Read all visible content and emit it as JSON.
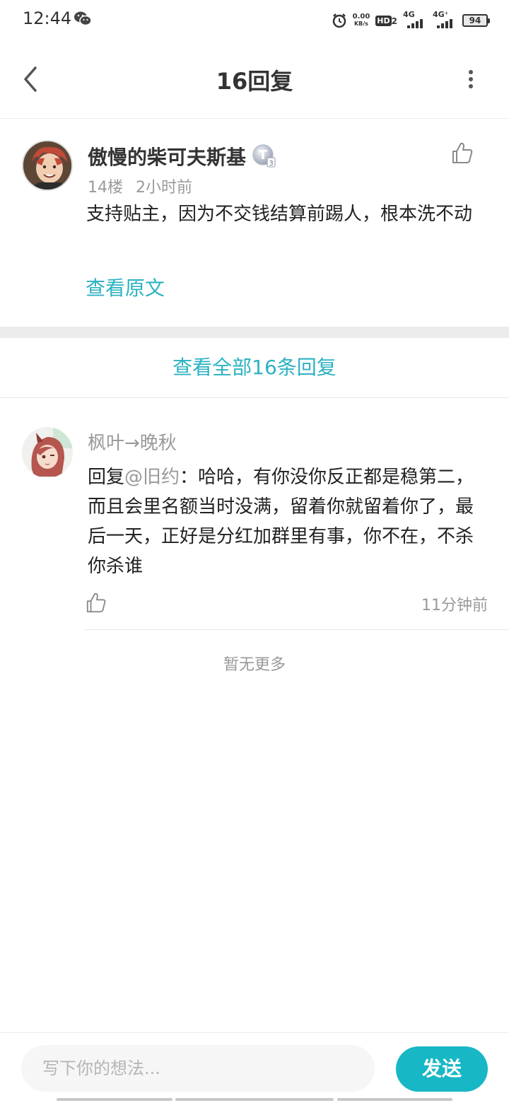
{
  "status_bar": {
    "time": "12:44",
    "net_speed_value": "0.00",
    "net_speed_unit": "KB/s",
    "hd_label": "HD",
    "hd_sub": "2",
    "net1": "4G",
    "net2": "4G⁺",
    "battery": "94",
    "icons": [
      "wechat-icon",
      "alarm-icon",
      "signal-icon",
      "battery-icon"
    ]
  },
  "header": {
    "title": "16回复"
  },
  "main_comment": {
    "author": "傲慢的柴可夫斯基",
    "badge_letter": "T",
    "badge_level": "3",
    "floor": "14楼",
    "time": "2小时前",
    "content": "支持贴主，因为不交钱结算前踢人，根本洗不动",
    "view_original": "查看原文"
  },
  "view_all": "查看全部16条回复",
  "replies": [
    {
      "author": "枫叶→晚秋",
      "prefix": "回复",
      "mention": "@旧约",
      "text": "：哈哈，有你没你反正都是稳第二，而且会里名额当时没满，留着你就留着你了，最后一天，正好是分红加群里有事，你不在，不杀你杀谁",
      "time": "11分钟前"
    }
  ],
  "no_more": "暂无更多",
  "input": {
    "placeholder": "写下你的想法..."
  },
  "send_label": "发送",
  "colors": {
    "accent": "#2bb2c2",
    "send_button": "#17b7c5",
    "muted_text": "#999999",
    "divider": "#ececec"
  }
}
